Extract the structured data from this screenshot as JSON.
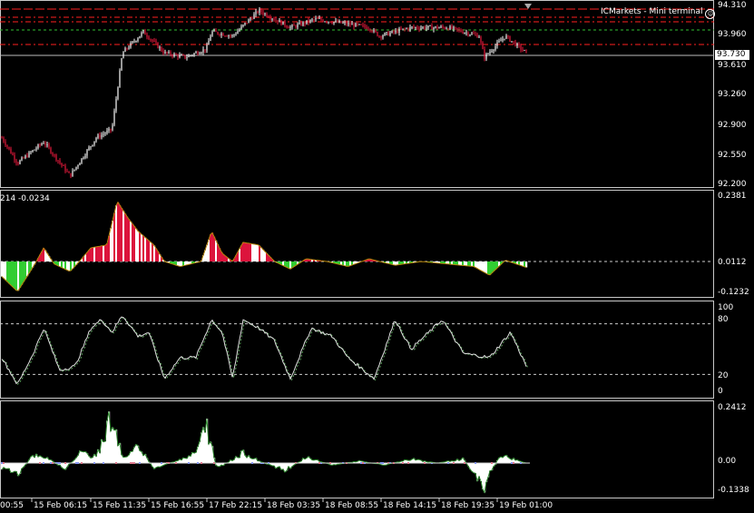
{
  "header": {
    "terminal_label": "ICMarkets - Mini terminal",
    "smiley": "☺"
  },
  "current_price": "93.730",
  "price_axis": {
    "ticks": [
      "94.310",
      "93.960",
      "93.610",
      "93.260",
      "92.900",
      "92.550",
      "92.200"
    ],
    "tick_values": [
      94.31,
      93.96,
      93.61,
      93.26,
      92.9,
      92.55,
      92.2
    ],
    "current_value": 93.73
  },
  "indicator1": {
    "label": "214 -0.0234",
    "ticks": [
      "0.2381",
      "0.0112",
      "-0.1232"
    ]
  },
  "indicator2": {
    "ticks": [
      "100",
      "80",
      "20",
      "0"
    ]
  },
  "indicator3": {
    "ticks": [
      "0.2412",
      "0.00",
      "-0.1338"
    ]
  },
  "time_axis": {
    "labels": [
      "00:55",
      "15 Feb 06:15",
      "15 Feb 11:35",
      "15 Feb 16:55",
      "17 Feb 22:15",
      "18 Feb 03:35",
      "18 Feb 08:55",
      "18 Feb 14:15",
      "18 Feb 19:35",
      "19 Feb 01:00"
    ]
  },
  "colors": {
    "background": "#000000",
    "bull_candle": "#ffffff",
    "bear_candle": "#e8193c",
    "hist_red": "#dc143c",
    "hist_green": "#32cd32",
    "hist_white": "#ffffff",
    "oscillator_line": "#e0e0e0",
    "level_red": "#ff2020",
    "level_green": "#30c030"
  },
  "chart_data": {
    "type": "table",
    "price_anchors": [
      {
        "t": 0,
        "v": 92.75
      },
      {
        "t": 0.03,
        "v": 92.45
      },
      {
        "t": 0.08,
        "v": 92.7
      },
      {
        "t": 0.13,
        "v": 92.3
      },
      {
        "t": 0.18,
        "v": 92.75
      },
      {
        "t": 0.21,
        "v": 92.85
      },
      {
        "t": 0.23,
        "v": 93.75
      },
      {
        "t": 0.27,
        "v": 94.0
      },
      {
        "t": 0.31,
        "v": 93.75
      },
      {
        "t": 0.35,
        "v": 93.7
      },
      {
        "t": 0.39,
        "v": 93.8
      },
      {
        "t": 0.4,
        "v": 94.0
      },
      {
        "t": 0.44,
        "v": 93.95
      },
      {
        "t": 0.49,
        "v": 94.25
      },
      {
        "t": 0.55,
        "v": 94.05
      },
      {
        "t": 0.6,
        "v": 94.15
      },
      {
        "t": 0.65,
        "v": 94.1
      },
      {
        "t": 0.7,
        "v": 94.05
      },
      {
        "t": 0.72,
        "v": 93.95
      },
      {
        "t": 0.78,
        "v": 94.05
      },
      {
        "t": 0.85,
        "v": 94.05
      },
      {
        "t": 0.91,
        "v": 93.95
      },
      {
        "t": 0.92,
        "v": 93.7
      },
      {
        "t": 0.96,
        "v": 93.95
      },
      {
        "t": 1.0,
        "v": 93.75
      }
    ],
    "indicator1_anchors": [
      {
        "t": 0,
        "v": -0.06
      },
      {
        "t": 0.03,
        "v": -0.12
      },
      {
        "t": 0.06,
        "v": -0.02
      },
      {
        "t": 0.08,
        "v": 0.05
      },
      {
        "t": 0.1,
        "v": -0.01
      },
      {
        "t": 0.13,
        "v": -0.04
      },
      {
        "t": 0.17,
        "v": 0.05
      },
      {
        "t": 0.2,
        "v": 0.06
      },
      {
        "t": 0.22,
        "v": 0.22
      },
      {
        "t": 0.24,
        "v": 0.16
      },
      {
        "t": 0.26,
        "v": 0.11
      },
      {
        "t": 0.29,
        "v": 0.06
      },
      {
        "t": 0.31,
        "v": 0.0
      },
      {
        "t": 0.34,
        "v": -0.02
      },
      {
        "t": 0.38,
        "v": 0.0
      },
      {
        "t": 0.4,
        "v": 0.11
      },
      {
        "t": 0.42,
        "v": 0.03
      },
      {
        "t": 0.44,
        "v": 0.0
      },
      {
        "t": 0.46,
        "v": 0.07
      },
      {
        "t": 0.49,
        "v": 0.06
      },
      {
        "t": 0.52,
        "v": 0.0
      },
      {
        "t": 0.55,
        "v": -0.03
      },
      {
        "t": 0.58,
        "v": 0.01
      },
      {
        "t": 0.62,
        "v": 0.0
      },
      {
        "t": 0.66,
        "v": -0.02
      },
      {
        "t": 0.7,
        "v": 0.01
      },
      {
        "t": 0.75,
        "v": -0.015
      },
      {
        "t": 0.8,
        "v": 0.0
      },
      {
        "t": 0.85,
        "v": -0.01
      },
      {
        "t": 0.9,
        "v": -0.02
      },
      {
        "t": 0.93,
        "v": -0.055
      },
      {
        "t": 0.96,
        "v": 0.005
      },
      {
        "t": 1.0,
        "v": -0.0234
      }
    ],
    "indicator2_anchors": [
      {
        "t": 0,
        "v": 40
      },
      {
        "t": 0.03,
        "v": 8
      },
      {
        "t": 0.06,
        "v": 45
      },
      {
        "t": 0.08,
        "v": 75
      },
      {
        "t": 0.11,
        "v": 25
      },
      {
        "t": 0.14,
        "v": 30
      },
      {
        "t": 0.17,
        "v": 75
      },
      {
        "t": 0.19,
        "v": 85
      },
      {
        "t": 0.21,
        "v": 70
      },
      {
        "t": 0.23,
        "v": 90
      },
      {
        "t": 0.26,
        "v": 65
      },
      {
        "t": 0.28,
        "v": 70
      },
      {
        "t": 0.31,
        "v": 15
      },
      {
        "t": 0.34,
        "v": 40
      },
      {
        "t": 0.37,
        "v": 40
      },
      {
        "t": 0.4,
        "v": 85
      },
      {
        "t": 0.42,
        "v": 70
      },
      {
        "t": 0.44,
        "v": 15
      },
      {
        "t": 0.46,
        "v": 85
      },
      {
        "t": 0.49,
        "v": 75
      },
      {
        "t": 0.52,
        "v": 60
      },
      {
        "t": 0.55,
        "v": 15
      },
      {
        "t": 0.59,
        "v": 75
      },
      {
        "t": 0.63,
        "v": 65
      },
      {
        "t": 0.66,
        "v": 40
      },
      {
        "t": 0.71,
        "v": 15
      },
      {
        "t": 0.75,
        "v": 85
      },
      {
        "t": 0.78,
        "v": 50
      },
      {
        "t": 0.84,
        "v": 85
      },
      {
        "t": 0.88,
        "v": 45
      },
      {
        "t": 0.93,
        "v": 40
      },
      {
        "t": 0.97,
        "v": 70
      },
      {
        "t": 1.0,
        "v": 30
      }
    ],
    "indicator3_anchors": [
      {
        "t": 0,
        "v": -0.03
      },
      {
        "t": 0.03,
        "v": -0.06
      },
      {
        "t": 0.06,
        "v": 0.04
      },
      {
        "t": 0.09,
        "v": 0.02
      },
      {
        "t": 0.12,
        "v": -0.03
      },
      {
        "t": 0.15,
        "v": 0.05
      },
      {
        "t": 0.18,
        "v": 0.03
      },
      {
        "t": 0.21,
        "v": 0.24
      },
      {
        "t": 0.23,
        "v": 0.02
      },
      {
        "t": 0.26,
        "v": 0.09
      },
      {
        "t": 0.29,
        "v": -0.03
      },
      {
        "t": 0.33,
        "v": 0.01
      },
      {
        "t": 0.37,
        "v": 0.05
      },
      {
        "t": 0.39,
        "v": 0.19
      },
      {
        "t": 0.41,
        "v": -0.03
      },
      {
        "t": 0.46,
        "v": 0.05
      },
      {
        "t": 0.5,
        "v": 0.0
      },
      {
        "t": 0.54,
        "v": -0.04
      },
      {
        "t": 0.58,
        "v": 0.03
      },
      {
        "t": 0.63,
        "v": -0.01
      },
      {
        "t": 0.68,
        "v": 0.01
      },
      {
        "t": 0.73,
        "v": -0.01
      },
      {
        "t": 0.78,
        "v": 0.02
      },
      {
        "t": 0.83,
        "v": 0.0
      },
      {
        "t": 0.88,
        "v": 0.02
      },
      {
        "t": 0.92,
        "v": -0.12
      },
      {
        "t": 0.95,
        "v": 0.04
      },
      {
        "t": 1.0,
        "v": 0.0
      }
    ]
  }
}
